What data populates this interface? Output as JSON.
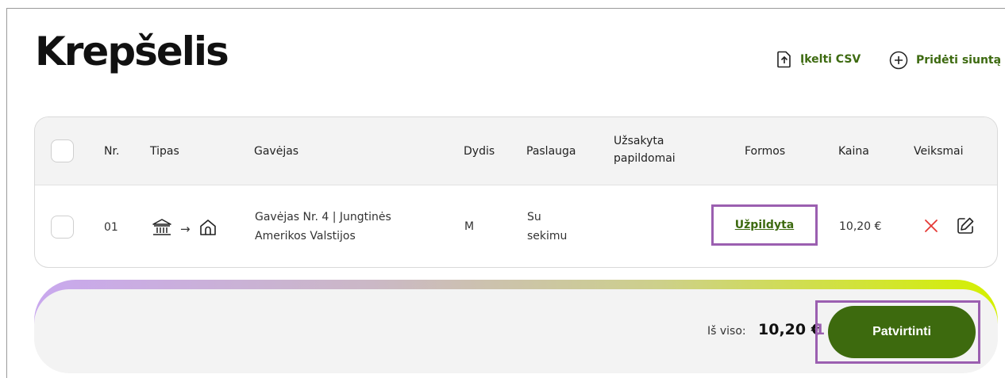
{
  "page": {
    "title": "Krepšelis"
  },
  "actions": {
    "upload_csv": "Įkelti CSV",
    "add_shipment": "Pridėti siuntą"
  },
  "table": {
    "headers": {
      "nr": "Nr.",
      "tipas": "Tipas",
      "gavejas": "Gavėjas",
      "dydis": "Dydis",
      "paslauga": "Paslauga",
      "uzsakyta_line1": "Užsakyta",
      "uzsakyta_line2": "papildomai",
      "formos": "Formos",
      "kaina": "Kaina",
      "veiksmai": "Veiksmai"
    },
    "rows": [
      {
        "nr": "01",
        "type_from_icon": "post-office-icon",
        "type_arrow": "→",
        "type_to_icon": "home-icon",
        "recipient_line1": "Gavėjas Nr. 4 | Jungtinės",
        "recipient_line2": "Amerikos Valstijos",
        "size": "M",
        "service_line1": "Su",
        "service_line2": "sekimu",
        "extras": "",
        "forms": "Užpildyta",
        "price": "10,20 €"
      }
    ]
  },
  "footer": {
    "total_label": "Iš viso:",
    "total_value": "10,20 €",
    "total_suffix": "1",
    "confirm_label": "Patvirtinti"
  },
  "colors": {
    "accent_green": "#3d6a0e",
    "highlight_purple": "#9b5fb0",
    "delete_red": "#e53935"
  }
}
